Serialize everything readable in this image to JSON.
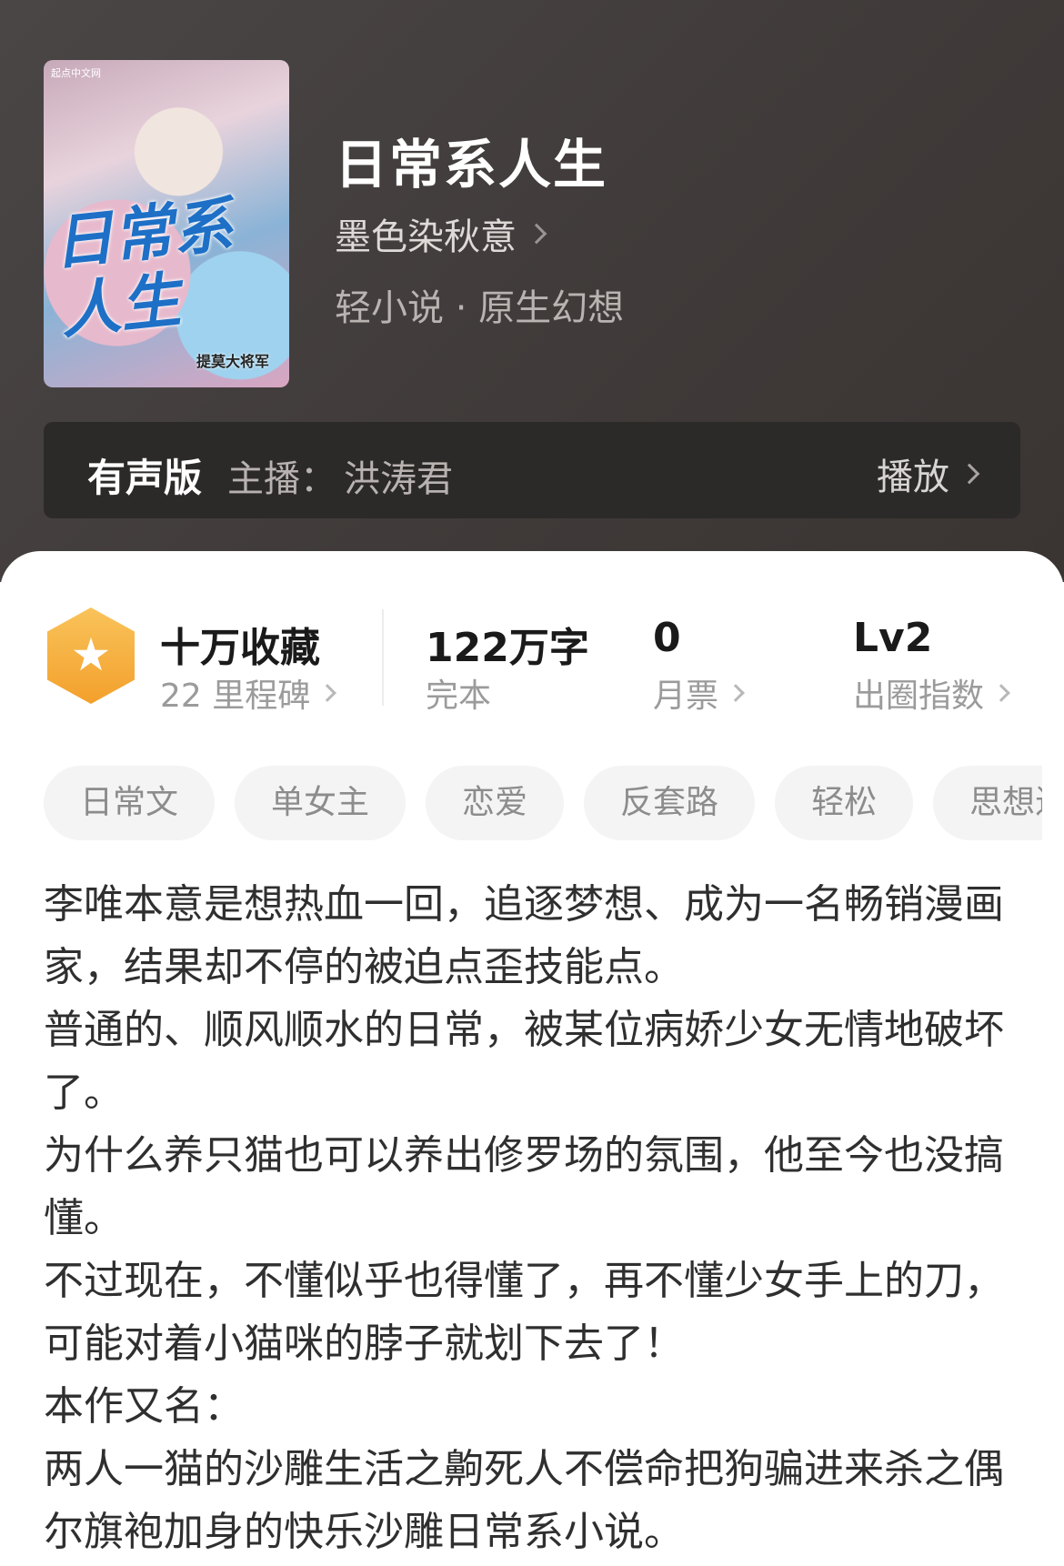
{
  "book": {
    "cover_badge": "起点中文网",
    "cover_title": "日常系人生",
    "cover_author": "提莫大将军",
    "title": "日常系人生",
    "author": "墨色染秋意",
    "genre": "轻小说 · 原生幻想"
  },
  "audio": {
    "label": "有声版",
    "host_label": "主播：",
    "host_name": "洪涛君",
    "play_label": "播放"
  },
  "stats": {
    "collections": "十万收藏",
    "milestones": "22 里程碑",
    "word_count": "122万字",
    "status": "完本",
    "monthly_votes": "0",
    "monthly_votes_label": "月票",
    "level": "Lv2",
    "level_label": "出圈指数"
  },
  "tags": [
    "日常文",
    "单女主",
    "恋爱",
    "反套路",
    "轻松",
    "思想进"
  ],
  "synopsis": [
    "李唯本意是想热血一回，追逐梦想、成为一名畅销漫画家，结果却不停的被迫点歪技能点。",
    "普通的、顺风顺水的日常，被某位病娇少女无情地破坏了。",
    "为什么养只猫也可以养出修罗场的氛围，他至今也没搞懂。",
    "不过现在，不懂似乎也得懂了，再不懂少女手上的刀，可能对着小猫咪的脖子就划下去了！",
    "本作又名：",
    "两人一猫的沙雕生活之齁死人不偿命把狗骗进来杀之偶尔旗袍加身的快乐沙雕日常系小说。"
  ]
}
